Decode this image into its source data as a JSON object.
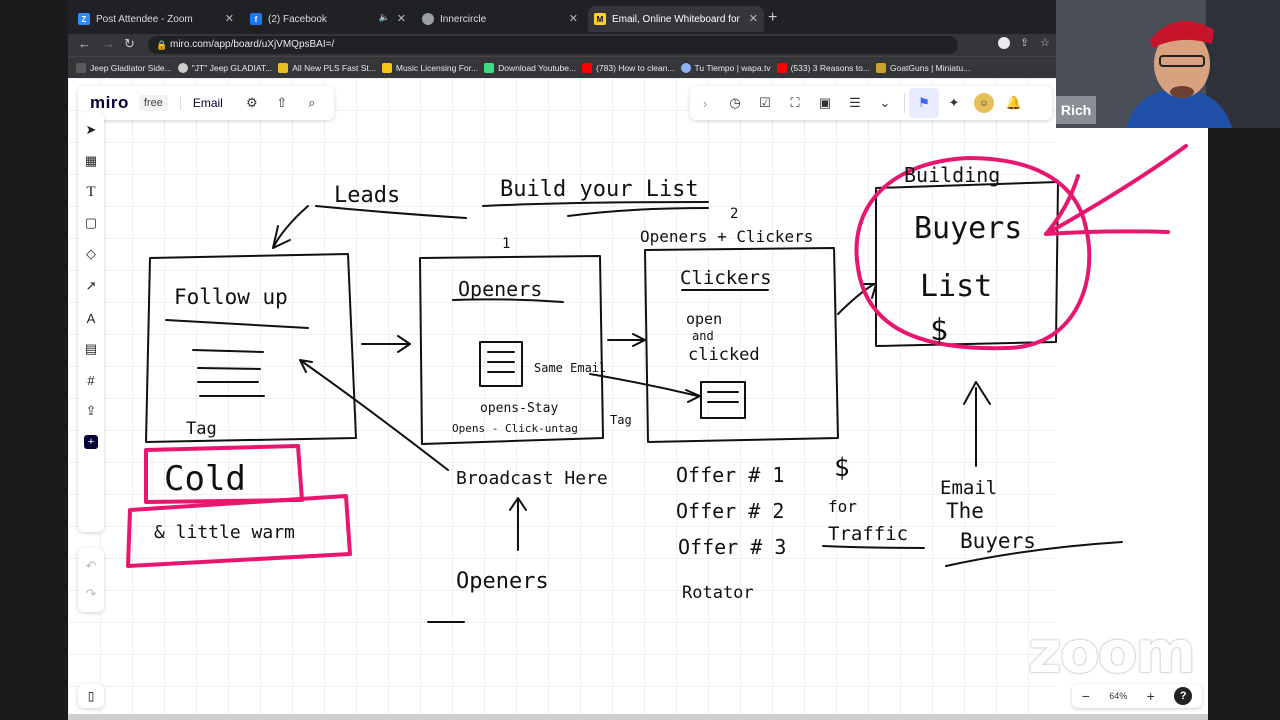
{
  "browser": {
    "tabs": [
      {
        "label": "Post Attendee - Zoom",
        "icon": "zoom-favicon",
        "color": "#2d8cff"
      },
      {
        "label": "(2) Facebook",
        "icon": "facebook-favicon",
        "color": "#1877f2"
      },
      {
        "label": "Innercircle",
        "icon": "globe-favicon",
        "color": "#9aa0a6"
      },
      {
        "label": "Email, Online Whiteboard for Vis",
        "icon": "miro-favicon",
        "color": "#ffd02f"
      }
    ],
    "url": "miro.com/app/board/uXjVMQpsBAI=/",
    "bookmarks": [
      {
        "label": "Jeep Gladiator Side...",
        "color": "#5a5a5a"
      },
      {
        "label": "\"JT\" Jeep GLADIAT...",
        "color": "#cccccc"
      },
      {
        "label": "All New PLS Fast St...",
        "color": "#e8c020"
      },
      {
        "label": "Music Licensing For...",
        "color": "#f5c518"
      },
      {
        "label": "Download Youtube...",
        "color": "#3ddc84"
      },
      {
        "label": "(783) How to clean...",
        "color": "#ff0000"
      },
      {
        "label": "Tu Tiempo | wapa.tv",
        "color": "#8ab4f8"
      },
      {
        "label": "(533) 3 Reasons to...",
        "color": "#ff0000"
      },
      {
        "label": "GoatGuns | Miniatu...",
        "color": "#c9a227"
      }
    ]
  },
  "miro": {
    "logo": "miro",
    "plan": "free",
    "board_name": "Email",
    "zoom_level": "64%",
    "help": "?",
    "accent": "#4262ff"
  },
  "participant": {
    "name": "Rich"
  },
  "watermark": "zoom",
  "whiteboard": {
    "header_leads": "Leads",
    "header_build": "Build your List",
    "num_2": "2",
    "num_1": "1",
    "openers_clickers": "Openers + Clickers",
    "followup": "Follow up",
    "tag": "Tag",
    "cold": "Cold",
    "little_warm": "& little warm",
    "openers_box": "Openers",
    "same_email": "Same Email",
    "opens_stay": "opens-Stay",
    "opens_click": "Opens - Click-untag",
    "tag2": "Tag",
    "clickers": "Clickers",
    "open": "open",
    "and": "and",
    "clicked": "clicked",
    "building": "Building",
    "buyers": "Buyers",
    "list": "List",
    "dollar": "$",
    "broadcast": "Broadcast Here",
    "openers_bottom": "Openers",
    "offer1": "Offer # 1",
    "offer2": "Offer # 2",
    "offer3": "Offer # 3",
    "rotator": "Rotator",
    "dollar2": "$",
    "for_text": "for",
    "traffic": "Traffic",
    "email": "Email",
    "the": "The",
    "buyers2": "Buyers",
    "ink_color": "#111111",
    "highlight_color": "#e8166f"
  }
}
